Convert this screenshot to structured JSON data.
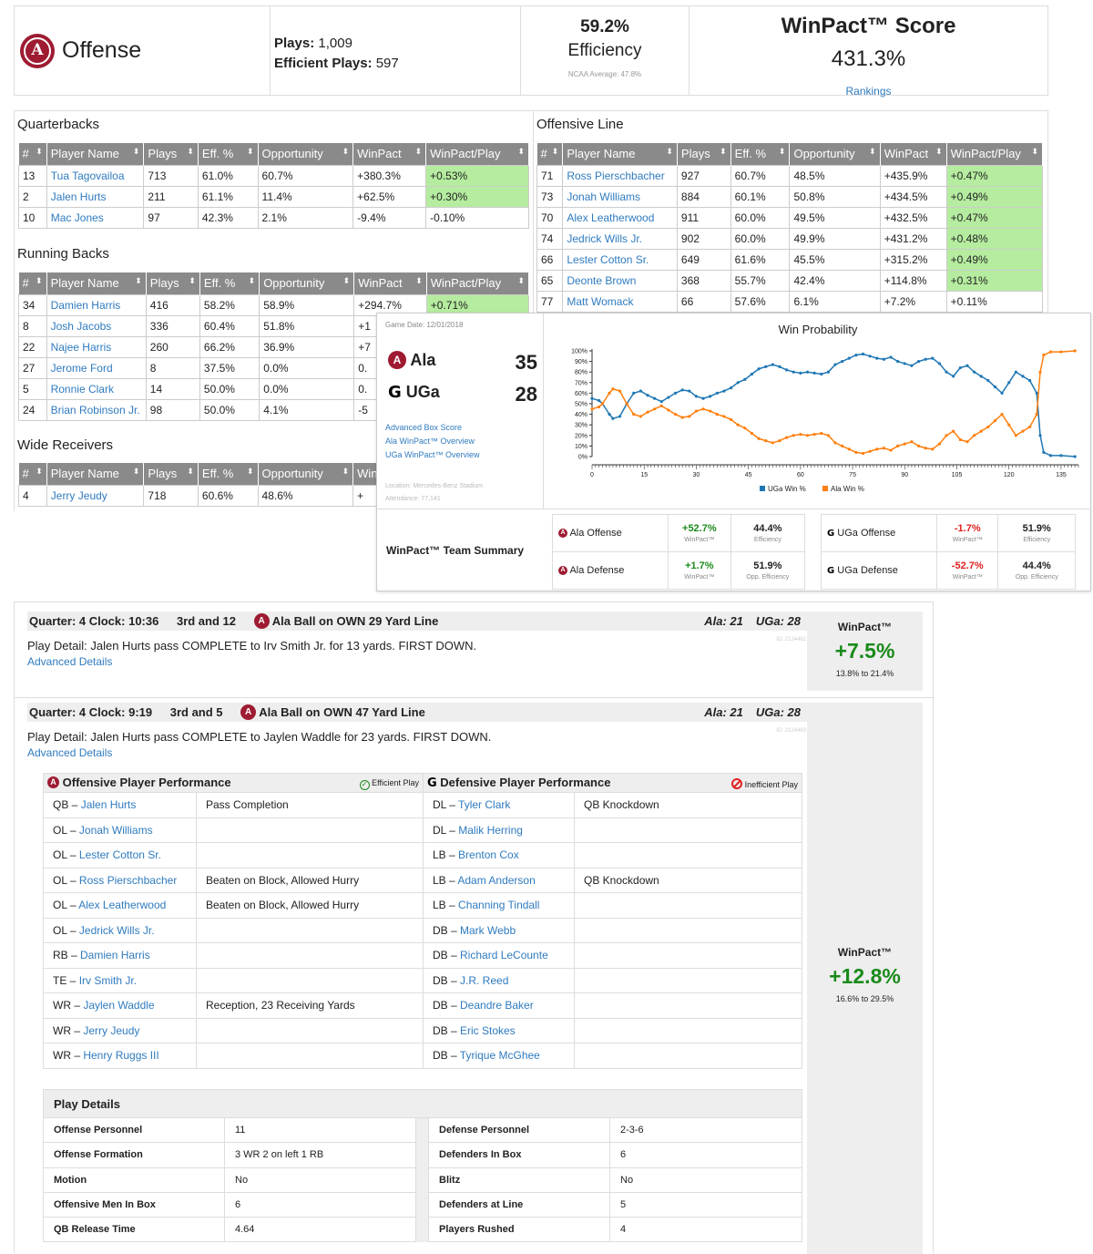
{
  "summary": {
    "team_title": "Offense",
    "plays_label": "Plays:",
    "plays_value": "1,009",
    "efficient_label": "Efficient Plays:",
    "efficient_value": "597",
    "efficiency_pct": "59.2%",
    "efficiency_label": "Efficiency",
    "ncaa_avg": "NCAA Average: 47.8%",
    "winpact_title": "WinPact™ Score",
    "winpact_value": "431.3%",
    "rankings_link": "Rankings"
  },
  "headers": {
    "qb": [
      "#",
      "Player Name",
      "Plays",
      "Eff. %",
      "Opportunity",
      "WinPact",
      "WinPact/Play"
    ]
  },
  "sections": {
    "qb": "Quarterbacks",
    "rb": "Running Backs",
    "wr": "Wide Receivers",
    "ol": "Offensive Line"
  },
  "quarterbacks": [
    {
      "num": "13",
      "name": "Tua Tagovailoa",
      "plays": "713",
      "eff": "61.0%",
      "opp": "60.7%",
      "wp": "+380.3%",
      "wpp": "+0.53%",
      "green": true
    },
    {
      "num": "2",
      "name": "Jalen Hurts",
      "plays": "211",
      "eff": "61.1%",
      "opp": "11.4%",
      "wp": "+62.5%",
      "wpp": "+0.30%",
      "green": true
    },
    {
      "num": "10",
      "name": "Mac Jones",
      "plays": "97",
      "eff": "42.3%",
      "opp": "2.1%",
      "wp": "-9.4%",
      "wpp": "-0.10%",
      "green": false
    }
  ],
  "running_backs": [
    {
      "num": "34",
      "name": "Damien Harris",
      "plays": "416",
      "eff": "58.2%",
      "opp": "58.9%",
      "wp": "+294.7%",
      "wpp": "+0.71%",
      "green": true
    },
    {
      "num": "8",
      "name": "Josh Jacobs",
      "plays": "336",
      "eff": "60.4%",
      "opp": "51.8%",
      "wp": "+1",
      "wpp": "",
      "green": false
    },
    {
      "num": "22",
      "name": "Najee Harris",
      "plays": "260",
      "eff": "66.2%",
      "opp": "36.9%",
      "wp": "+7",
      "wpp": "",
      "green": false
    },
    {
      "num": "27",
      "name": "Jerome Ford",
      "plays": "8",
      "eff": "37.5%",
      "opp": "0.0%",
      "wp": "0.",
      "wpp": "",
      "green": false
    },
    {
      "num": "5",
      "name": "Ronnie Clark",
      "plays": "14",
      "eff": "50.0%",
      "opp": "0.0%",
      "wp": "0.",
      "wpp": "",
      "green": false
    },
    {
      "num": "24",
      "name": "Brian Robinson Jr.",
      "plays": "98",
      "eff": "50.0%",
      "opp": "4.1%",
      "wp": "-5",
      "wpp": "",
      "green": false
    }
  ],
  "wide_receivers": [
    {
      "num": "4",
      "name": "Jerry Jeudy",
      "plays": "718",
      "eff": "60.6%",
      "opp": "48.6%",
      "wp": "+",
      "wpp": "",
      "green": false
    }
  ],
  "offensive_line": [
    {
      "num": "71",
      "name": "Ross Pierschbacher",
      "plays": "927",
      "eff": "60.7%",
      "opp": "48.5%",
      "wp": "+435.9%",
      "wpp": "+0.47%",
      "green": true
    },
    {
      "num": "73",
      "name": "Jonah Williams",
      "plays": "884",
      "eff": "60.1%",
      "opp": "50.8%",
      "wp": "+434.5%",
      "wpp": "+0.49%",
      "green": true
    },
    {
      "num": "70",
      "name": "Alex Leatherwood",
      "plays": "911",
      "eff": "60.0%",
      "opp": "49.5%",
      "wp": "+432.5%",
      "wpp": "+0.47%",
      "green": true
    },
    {
      "num": "74",
      "name": "Jedrick Wills Jr.",
      "plays": "902",
      "eff": "60.0%",
      "opp": "49.9%",
      "wp": "+431.2%",
      "wpp": "+0.48%",
      "green": true
    },
    {
      "num": "66",
      "name": "Lester Cotton Sr.",
      "plays": "649",
      "eff": "61.6%",
      "opp": "45.5%",
      "wp": "+315.2%",
      "wpp": "+0.49%",
      "green": true
    },
    {
      "num": "65",
      "name": "Deonte Brown",
      "plays": "368",
      "eff": "55.7%",
      "opp": "42.4%",
      "wp": "+114.8%",
      "wpp": "+0.31%",
      "green": true
    },
    {
      "num": "77",
      "name": "Matt Womack",
      "plays": "66",
      "eff": "57.6%",
      "opp": "6.1%",
      "wp": "+7.2%",
      "wpp": "+0.11%",
      "green": false
    }
  ],
  "game": {
    "date": "Game Date: 12/01/2018",
    "team1": "Ala",
    "score1": "35",
    "team2": "UGa",
    "score2": "28",
    "links": [
      "Advanced Box Score",
      "Ala WinPact™ Overview",
      "UGa WinPact™ Overview"
    ],
    "location": "Location: Mercedes-Benz Stadium",
    "attendance": "Attendance: 77,141",
    "summary_title": "WinPact™ Team Summary",
    "summary_left": [
      {
        "name": "Ala Offense",
        "wp": "+52.7%",
        "wp_label": "WinPact™",
        "eff": "44.4%",
        "eff_label": "Efficiency"
      },
      {
        "name": "Ala Defense",
        "wp": "+1.7%",
        "wp_label": "WinPact™",
        "eff": "51.9%",
        "eff_label": "Opp. Efficiency"
      }
    ],
    "summary_right": [
      {
        "name": "UGa Offense",
        "wp": "-1.7%",
        "wp_label": "WinPact™",
        "eff": "51.9%",
        "eff_label": "Efficiency"
      },
      {
        "name": "UGa Defense",
        "wp": "-52.7%",
        "wp_label": "WinPact™",
        "eff": "44.4%",
        "eff_label": "Opp. Efficiency"
      }
    ]
  },
  "chart_data": {
    "type": "line",
    "title": "Win Probability",
    "xlabel": "",
    "ylabel": "",
    "xlim": [
      0,
      140
    ],
    "ylim": [
      0,
      100
    ],
    "x_ticks": [
      0,
      15,
      30,
      45,
      60,
      75,
      90,
      105,
      120,
      135
    ],
    "y_ticks": [
      "0%",
      "10%",
      "20%",
      "30%",
      "40%",
      "50%",
      "60%",
      "70%",
      "80%",
      "90%",
      "100%"
    ],
    "legend_position": "bottom",
    "colors": {
      "uga": "#1f77b4",
      "ala": "#ff7f0e"
    },
    "series": [
      {
        "name": "UGa Win %",
        "points": [
          [
            0,
            55
          ],
          [
            2,
            53
          ],
          [
            3,
            50
          ],
          [
            5,
            40
          ],
          [
            6,
            36
          ],
          [
            8,
            38
          ],
          [
            10,
            50
          ],
          [
            12,
            60
          ],
          [
            14,
            62
          ],
          [
            16,
            58
          ],
          [
            18,
            55
          ],
          [
            20,
            52
          ],
          [
            22,
            56
          ],
          [
            24,
            60
          ],
          [
            26,
            63
          ],
          [
            28,
            62
          ],
          [
            30,
            57
          ],
          [
            32,
            55
          ],
          [
            34,
            57
          ],
          [
            36,
            60
          ],
          [
            38,
            62
          ],
          [
            40,
            65
          ],
          [
            42,
            70
          ],
          [
            44,
            73
          ],
          [
            46,
            78
          ],
          [
            48,
            83
          ],
          [
            50,
            85
          ],
          [
            52,
            87
          ],
          [
            54,
            85
          ],
          [
            56,
            82
          ],
          [
            58,
            80
          ],
          [
            60,
            79
          ],
          [
            62,
            80
          ],
          [
            64,
            79
          ],
          [
            66,
            78
          ],
          [
            68,
            80
          ],
          [
            70,
            87
          ],
          [
            72,
            90
          ],
          [
            74,
            93
          ],
          [
            76,
            96
          ],
          [
            78,
            97
          ],
          [
            80,
            95
          ],
          [
            82,
            93
          ],
          [
            84,
            92
          ],
          [
            86,
            94
          ],
          [
            88,
            90
          ],
          [
            90,
            88
          ],
          [
            92,
            86
          ],
          [
            94,
            90
          ],
          [
            96,
            92
          ],
          [
            98,
            93
          ],
          [
            100,
            88
          ],
          [
            102,
            80
          ],
          [
            104,
            76
          ],
          [
            106,
            84
          ],
          [
            108,
            86
          ],
          [
            110,
            80
          ],
          [
            112,
            76
          ],
          [
            114,
            72
          ],
          [
            116,
            66
          ],
          [
            118,
            60
          ],
          [
            120,
            70
          ],
          [
            122,
            80
          ],
          [
            124,
            76
          ],
          [
            126,
            72
          ],
          [
            128,
            60
          ],
          [
            129,
            20
          ],
          [
            130,
            4
          ],
          [
            132,
            1
          ],
          [
            135,
            1
          ],
          [
            139,
            0
          ]
        ]
      },
      {
        "name": "Ala Win %",
        "points": [
          [
            0,
            45
          ],
          [
            2,
            47
          ],
          [
            3,
            50
          ],
          [
            5,
            60
          ],
          [
            6,
            64
          ],
          [
            8,
            62
          ],
          [
            10,
            50
          ],
          [
            12,
            40
          ],
          [
            14,
            38
          ],
          [
            16,
            42
          ],
          [
            18,
            45
          ],
          [
            20,
            48
          ],
          [
            22,
            44
          ],
          [
            24,
            40
          ],
          [
            26,
            37
          ],
          [
            28,
            38
          ],
          [
            30,
            43
          ],
          [
            32,
            45
          ],
          [
            34,
            43
          ],
          [
            36,
            40
          ],
          [
            38,
            38
          ],
          [
            40,
            35
          ],
          [
            42,
            30
          ],
          [
            44,
            27
          ],
          [
            46,
            22
          ],
          [
            48,
            17
          ],
          [
            50,
            15
          ],
          [
            52,
            13
          ],
          [
            54,
            15
          ],
          [
            56,
            18
          ],
          [
            58,
            20
          ],
          [
            60,
            21
          ],
          [
            62,
            20
          ],
          [
            64,
            21
          ],
          [
            66,
            22
          ],
          [
            68,
            20
          ],
          [
            70,
            13
          ],
          [
            72,
            10
          ],
          [
            74,
            7
          ],
          [
            76,
            4
          ],
          [
            78,
            3
          ],
          [
            80,
            5
          ],
          [
            82,
            7
          ],
          [
            84,
            8
          ],
          [
            86,
            6
          ],
          [
            88,
            10
          ],
          [
            90,
            12
          ],
          [
            92,
            14
          ],
          [
            94,
            10
          ],
          [
            96,
            8
          ],
          [
            98,
            7
          ],
          [
            100,
            12
          ],
          [
            102,
            20
          ],
          [
            104,
            24
          ],
          [
            106,
            16
          ],
          [
            108,
            14
          ],
          [
            110,
            20
          ],
          [
            112,
            24
          ],
          [
            114,
            28
          ],
          [
            116,
            34
          ],
          [
            118,
            40
          ],
          [
            120,
            30
          ],
          [
            122,
            20
          ],
          [
            124,
            24
          ],
          [
            126,
            28
          ],
          [
            128,
            40
          ],
          [
            129,
            80
          ],
          [
            130,
            96
          ],
          [
            132,
            99
          ],
          [
            135,
            99
          ],
          [
            139,
            100
          ]
        ]
      }
    ]
  },
  "plays": [
    {
      "quarter": "Quarter: 4 Clock: 10:36",
      "down": "3rd and 12",
      "ball": "Ala Ball on OWN 29 Yard Line",
      "score_ala": "Ala: 21",
      "score_uga": "UGa: 28",
      "detail": "Play Detail: Jalen Hurts pass COMPLETE to Irv Smith Jr. for 13 yards. FIRST DOWN.",
      "adv": "Advanced Details",
      "id": "ID: 2124462",
      "wp_title": "WinPact™",
      "wp_value": "+7.5%",
      "wp_range": "13.8% to 21.4%"
    },
    {
      "quarter": "Quarter: 4 Clock: 9:19",
      "down": "3rd and 5",
      "ball": "Ala Ball on OWN 47 Yard Line",
      "score_ala": "Ala: 21",
      "score_uga": "UGa: 28",
      "detail": "Play Detail: Jalen Hurts pass COMPLETE to Jaylen Waddle for 23 yards. FIRST DOWN.",
      "adv": "Advanced Details",
      "id": "ID: 2124463",
      "wp_title": "WinPact™",
      "wp_value": "+12.8%",
      "wp_range": "16.6% to 29.5%"
    }
  ],
  "performance": {
    "off_title": "Offensive Player Performance",
    "efficient_legend": "Efficient Play",
    "def_title": "Defensive Player Performance",
    "inefficient_legend": "Inefficient Play",
    "rows": [
      {
        "opos": "QB",
        "oname": "Jalen Hurts",
        "onote": "Pass Completion",
        "dpos": "DL",
        "dname": "Tyler Clark",
        "dnote": "QB Knockdown"
      },
      {
        "opos": "OL",
        "oname": "Jonah Williams",
        "onote": "",
        "dpos": "DL",
        "dname": "Malik Herring",
        "dnote": ""
      },
      {
        "opos": "OL",
        "oname": "Lester Cotton Sr.",
        "onote": "",
        "dpos": "LB",
        "dname": "Brenton Cox",
        "dnote": ""
      },
      {
        "opos": "OL",
        "oname": "Ross Pierschbacher",
        "onote": "Beaten on Block, Allowed Hurry",
        "dpos": "LB",
        "dname": "Adam Anderson",
        "dnote": "QB Knockdown"
      },
      {
        "opos": "OL",
        "oname": "Alex Leatherwood",
        "onote": "Beaten on Block, Allowed Hurry",
        "dpos": "LB",
        "dname": "Channing Tindall",
        "dnote": ""
      },
      {
        "opos": "OL",
        "oname": "Jedrick Wills Jr.",
        "onote": "",
        "dpos": "DB",
        "dname": "Mark Webb",
        "dnote": ""
      },
      {
        "opos": "RB",
        "oname": "Damien Harris",
        "onote": "",
        "dpos": "DB",
        "dname": "Richard LeCounte",
        "dnote": ""
      },
      {
        "opos": "TE",
        "oname": "Irv Smith Jr.",
        "onote": "",
        "dpos": "DB",
        "dname": "J.R. Reed",
        "dnote": ""
      },
      {
        "opos": "WR",
        "oname": "Jaylen Waddle",
        "onote": "Reception, 23 Receiving Yards",
        "dpos": "DB",
        "dname": "Deandre Baker",
        "dnote": ""
      },
      {
        "opos": "WR",
        "oname": "Jerry Jeudy",
        "onote": "",
        "dpos": "DB",
        "dname": "Eric Stokes",
        "dnote": ""
      },
      {
        "opos": "WR",
        "oname": "Henry Ruggs III",
        "onote": "",
        "dpos": "DB",
        "dname": "Tyrique McGhee",
        "dnote": ""
      }
    ]
  },
  "play_details": {
    "title": "Play Details",
    "rows": [
      {
        "k1": "Offense Personnel",
        "v1": "11",
        "k2": "Defense Personnel",
        "v2": "2-3-6"
      },
      {
        "k1": "Offense Formation",
        "v1": "3 WR 2 on left 1 RB",
        "k2": "Defenders In Box",
        "v2": "6"
      },
      {
        "k1": "Motion",
        "v1": "No",
        "k2": "Blitz",
        "v2": "No"
      },
      {
        "k1": "Offensive Men In Box",
        "v1": "6",
        "k2": "Defenders at Line",
        "v2": "5"
      },
      {
        "k1": "QB Release Time",
        "v1": "4.64",
        "k2": "Players Rushed",
        "v2": "4"
      }
    ]
  }
}
